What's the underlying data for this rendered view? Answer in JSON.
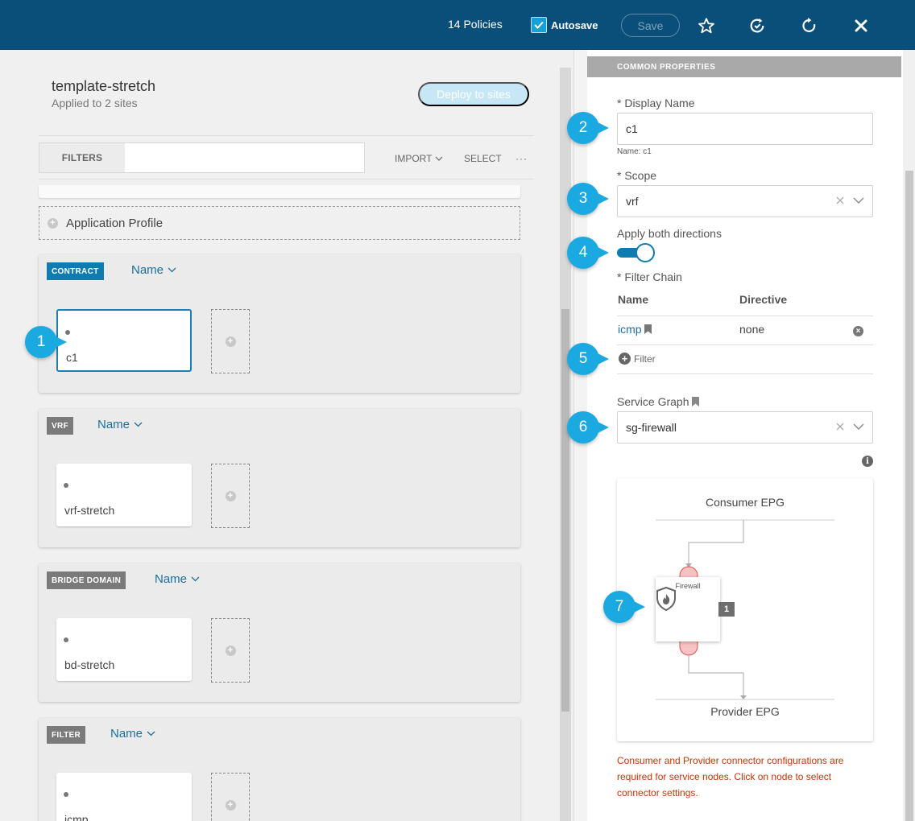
{
  "topbar": {
    "policies": "14 Policies",
    "autosave_label": "Autosave",
    "autosave_checked": true,
    "save_label": "Save",
    "icons": [
      "star-icon",
      "refresh-schedule-icon",
      "reload-icon",
      "close-icon"
    ]
  },
  "template": {
    "name": "template-stretch",
    "applied": "Applied to 2 sites",
    "deploy_label": "Deploy to sites"
  },
  "toolbar": {
    "filters_label": "FILTERS",
    "filters_value": "",
    "import_label": "IMPORT",
    "select_label": "SELECT",
    "more_label": "···"
  },
  "app_profile": {
    "label": "Application Profile"
  },
  "sections": [
    {
      "tag": "CONTRACT",
      "sort": "Name",
      "item": "c1"
    },
    {
      "tag": "VRF",
      "sort": "Name",
      "item": "vrf-stretch"
    },
    {
      "tag": "BRIDGE DOMAIN",
      "sort": "Name",
      "item": "bd-stretch"
    },
    {
      "tag": "FILTER",
      "sort": "Name",
      "item": "icmp"
    }
  ],
  "properties": {
    "header": "COMMON PROPERTIES",
    "display_name_label": "* Display Name",
    "display_name_value": "c1",
    "name_note": "Name: c1",
    "scope_label": "* Scope",
    "scope_value": "vrf",
    "apply_both_label": "Apply both directions",
    "apply_both_on": true,
    "filter_chain_label": "* Filter Chain",
    "col_name": "Name",
    "col_directive": "Directive",
    "chain": [
      {
        "name": "icmp",
        "directive": "none"
      }
    ],
    "add_filter_label": "Filter",
    "service_graph_label": "Service Graph",
    "service_graph_value": "sg-firewall",
    "graph": {
      "consumer": "Consumer EPG",
      "provider": "Provider EPG",
      "node_label": "Firewall",
      "node_badge": "1"
    },
    "warning": "Consumer and Provider connector configurations are required for service nodes. Click on node to select connector settings."
  },
  "callouts": [
    "1",
    "2",
    "3",
    "4",
    "5",
    "6",
    "7"
  ],
  "colors": {
    "topbar": "#0a4f79",
    "accent": "#0e7cb0",
    "callout": "#1aa9e0",
    "warning": "#cc3300"
  }
}
